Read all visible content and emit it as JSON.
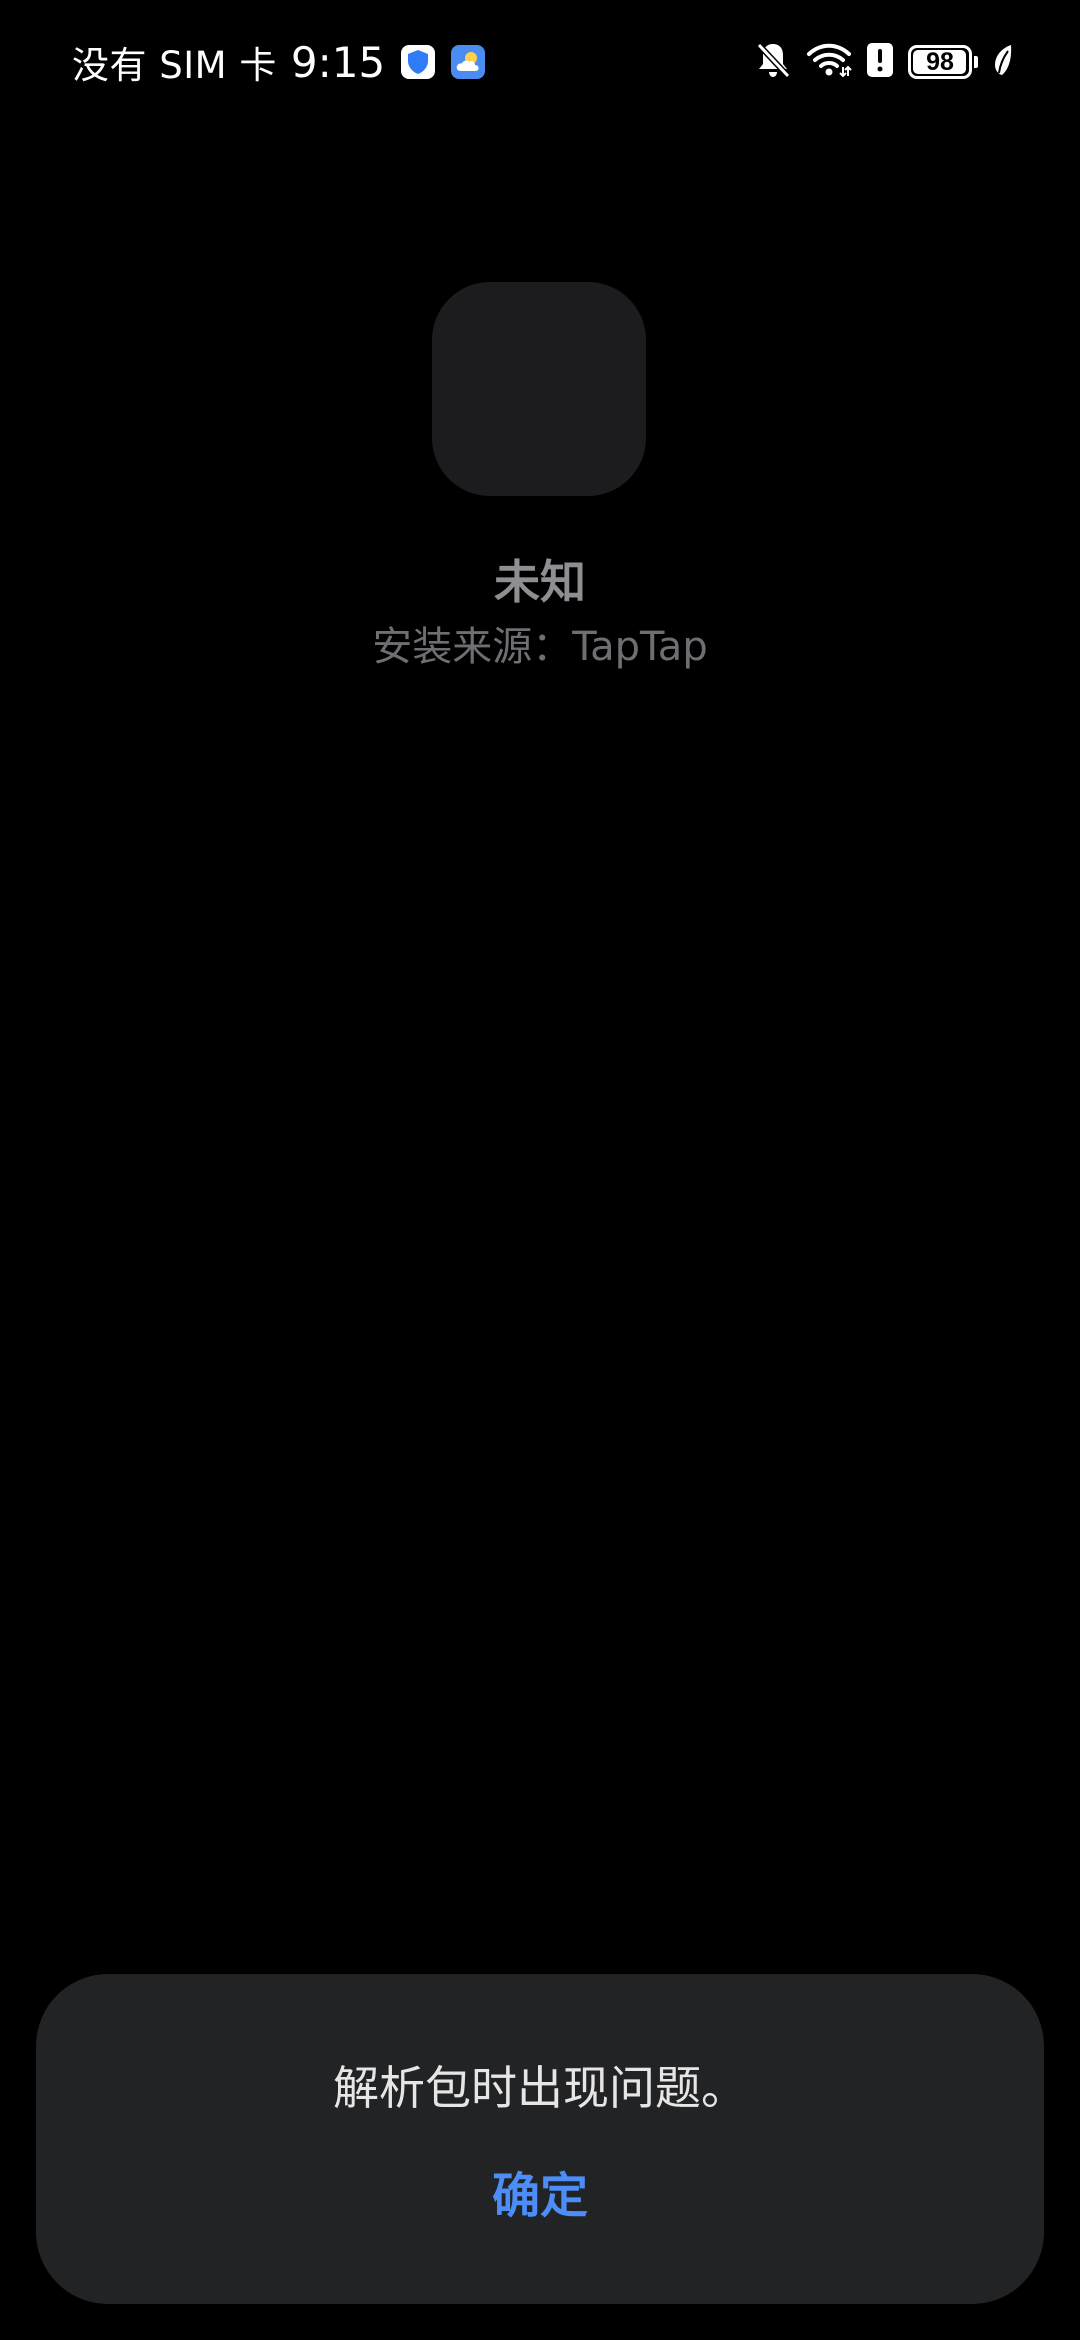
{
  "status_bar": {
    "carrier": "没有 SIM 卡",
    "time": "9:15",
    "notification_icons": [
      "security-shield-icon",
      "weather-icon"
    ],
    "system_icons": [
      "bell-muted-icon",
      "wifi-icon",
      "alert-icon",
      "battery-icon",
      "power-saving-leaf-icon"
    ],
    "battery_level": "98",
    "battery_fraction": 0.98
  },
  "app": {
    "name": "未知",
    "install_source": "安装来源：TapTap",
    "icon_color": "#1c1c1e"
  },
  "dialog": {
    "message": "解析包时出现问题。",
    "confirm_label": "确定",
    "accent_color": "#4d8df7",
    "background_color": "#222325"
  }
}
